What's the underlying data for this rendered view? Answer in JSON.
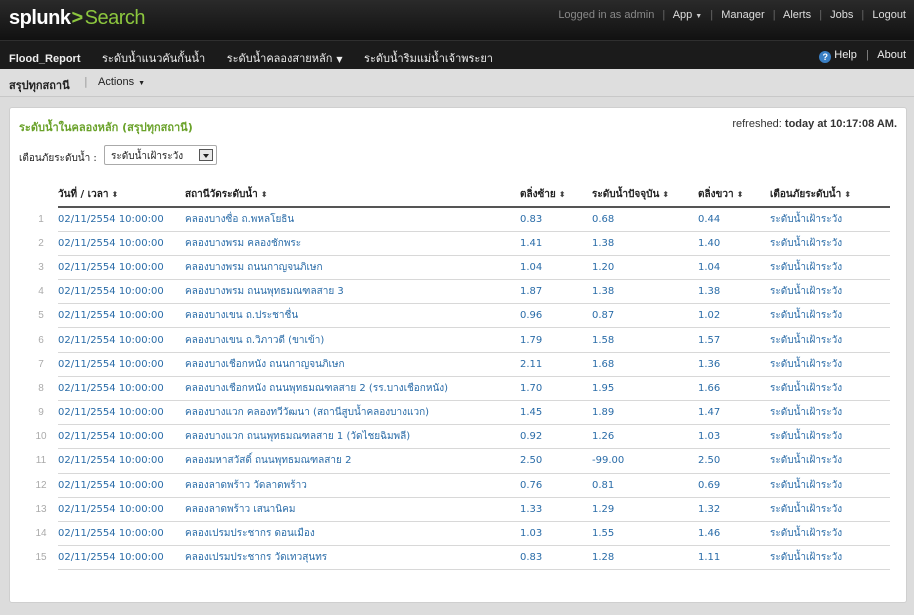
{
  "header": {
    "logo_text": "splunk",
    "logo_chevron": ">",
    "app_name": "Search",
    "logged_in": "Logged in as admin",
    "links": [
      "App",
      "Manager",
      "Alerts",
      "Jobs",
      "Logout"
    ]
  },
  "appnav": {
    "items": [
      "Flood_Report",
      "ระดับน้ำแนวคันกั้นน้ำ",
      "ระดับน้ำคลองสายหลัก",
      "ระดับน้ำริมแม่น้ำเจ้าพระยา"
    ],
    "help": "Help",
    "about": "About"
  },
  "view": {
    "title": "สรุปทุกสถานี",
    "actions": "Actions"
  },
  "panel": {
    "title": "ระดับน้ำในคลองหลัก (สรุปทุกสถานี)",
    "refreshed_label": "refreshed:",
    "refreshed_value": "today at 10:17:08 AM.",
    "filter_label": "เตือนภัยระดับน้ำ :",
    "filter_value": "ระดับน้ำเฝ้าระวัง"
  },
  "table": {
    "columns": [
      "วันที่ / เวลา",
      "สถานีวัดระดับน้ำ",
      "ตลิ่งซ้าย",
      "ระดับน้ำปัจจุบัน",
      "ตลิ่งขวา",
      "เตือนภัยระดับน้ำ"
    ],
    "rows": [
      [
        "1",
        "02/11/2554 10:00:00",
        "คลองบางซื่อ ถ.พหลโยธิน",
        "0.83",
        "0.68",
        "0.44",
        "ระดับน้ำเฝ้าระวัง"
      ],
      [
        "2",
        "02/11/2554 10:00:00",
        "คลองบางพรม คลองชักพระ",
        "1.41",
        "1.38",
        "1.40",
        "ระดับน้ำเฝ้าระวัง"
      ],
      [
        "3",
        "02/11/2554 10:00:00",
        "คลองบางพรม ถนนกาญจนภิเษก",
        "1.04",
        "1.20",
        "1.04",
        "ระดับน้ำเฝ้าระวัง"
      ],
      [
        "4",
        "02/11/2554 10:00:00",
        "คลองบางพรม ถนนพุทธมณฑลสาย 3",
        "1.87",
        "1.38",
        "1.38",
        "ระดับน้ำเฝ้าระวัง"
      ],
      [
        "5",
        "02/11/2554 10:00:00",
        "คลองบางเขน ถ.ประชาชื่น",
        "0.96",
        "0.87",
        "1.02",
        "ระดับน้ำเฝ้าระวัง"
      ],
      [
        "6",
        "02/11/2554 10:00:00",
        "คลองบางเขน ถ.วิภาวดี (ขาเข้า)",
        "1.79",
        "1.58",
        "1.57",
        "ระดับน้ำเฝ้าระวัง"
      ],
      [
        "7",
        "02/11/2554 10:00:00",
        "คลองบางเชือกหนัง ถนนกาญจนภิเษก",
        "2.11",
        "1.68",
        "1.36",
        "ระดับน้ำเฝ้าระวัง"
      ],
      [
        "8",
        "02/11/2554 10:00:00",
        "คลองบางเชือกหนัง ถนนพุทธมณฑลสาย 2 (รร.บางเชือกหนัง)",
        "1.70",
        "1.95",
        "1.66",
        "ระดับน้ำเฝ้าระวัง"
      ],
      [
        "9",
        "02/11/2554 10:00:00",
        "คลองบางแวก คลองทวีวัฒนา (สถานีสูบน้ำคลองบางแวก)",
        "1.45",
        "1.89",
        "1.47",
        "ระดับน้ำเฝ้าระวัง"
      ],
      [
        "10",
        "02/11/2554 10:00:00",
        "คลองบางแวก ถนนพุทธมณฑลสาย 1 (วัดไชยฉิมพลี)",
        "0.92",
        "1.26",
        "1.03",
        "ระดับน้ำเฝ้าระวัง"
      ],
      [
        "11",
        "02/11/2554 10:00:00",
        "คลองมหาสวัสดิ์ ถนนพุทธมณฑลสาย 2",
        "2.50",
        "-99.00",
        "2.50",
        "ระดับน้ำเฝ้าระวัง"
      ],
      [
        "12",
        "02/11/2554 10:00:00",
        "คลองลาดพร้าว วัดลาดพร้าว",
        "0.76",
        "0.81",
        "0.69",
        "ระดับน้ำเฝ้าระวัง"
      ],
      [
        "13",
        "02/11/2554 10:00:00",
        "คลองลาดพร้าว เสนานิคม",
        "1.33",
        "1.29",
        "1.32",
        "ระดับน้ำเฝ้าระวัง"
      ],
      [
        "14",
        "02/11/2554 10:00:00",
        "คลองเปรมประชากร ดอนเมือง",
        "1.03",
        "1.55",
        "1.46",
        "ระดับน้ำเฝ้าระวัง"
      ],
      [
        "15",
        "02/11/2554 10:00:00",
        "คลองเปรมประชากร วัดเทวสุนทร",
        "0.83",
        "1.28",
        "1.11",
        "ระดับน้ำเฝ้าระวัง"
      ]
    ]
  }
}
